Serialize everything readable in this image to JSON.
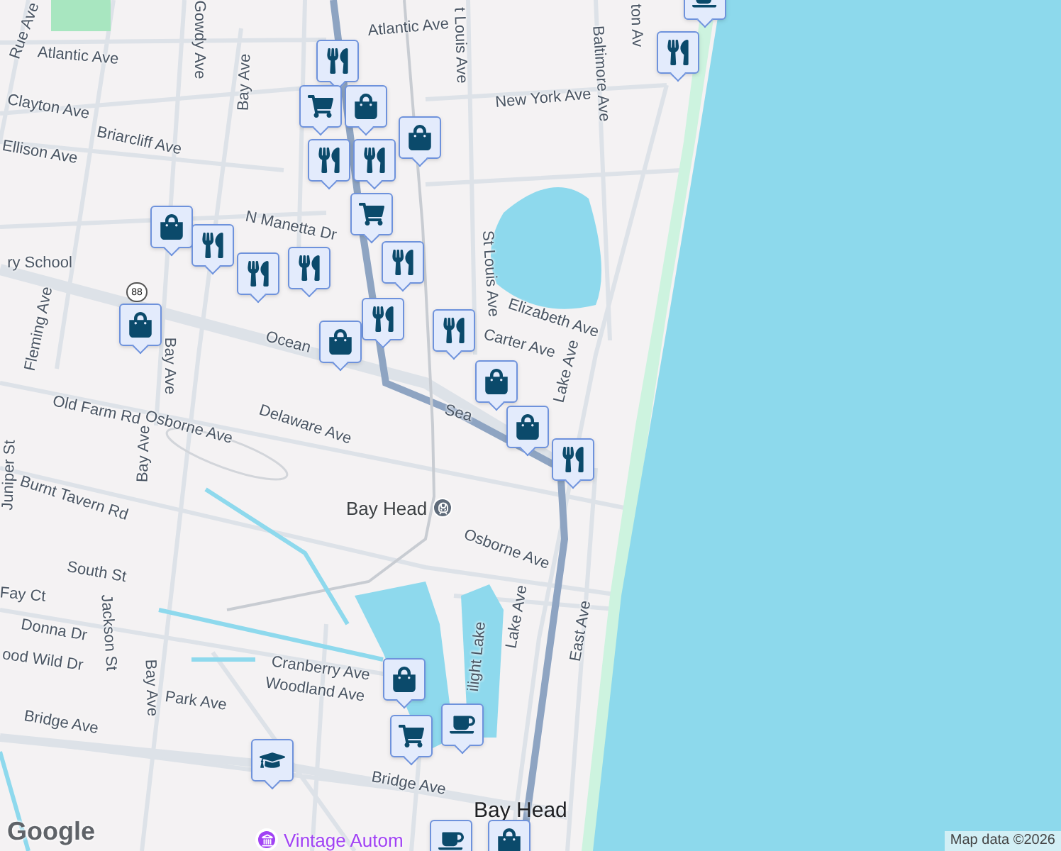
{
  "map": {
    "labels": [
      {
        "text": "Rue Ave"
      },
      {
        "text": "Atlantic Ave"
      },
      {
        "text": "Gowdy Ave"
      },
      {
        "text": "Bay Ave"
      },
      {
        "text": "Atlantic Ave"
      },
      {
        "text": "t Louis Ave"
      },
      {
        "text": "New York Ave"
      },
      {
        "text": "ton Av"
      },
      {
        "text": "Baltimore Ave"
      },
      {
        "text": "Clayton Ave"
      },
      {
        "text": "Briarcliff Ave"
      },
      {
        "text": "Ellison Ave"
      },
      {
        "text": "N Manetta Dr"
      },
      {
        "text": "ry School"
      },
      {
        "text": "St Louis Ave"
      },
      {
        "text": "Elizabeth Ave"
      },
      {
        "text": "Carter Ave"
      },
      {
        "text": "Fleming Ave"
      },
      {
        "text": "Bay Ave"
      },
      {
        "text": "Ocean"
      },
      {
        "text": "Lake Ave"
      },
      {
        "text": "Sea"
      },
      {
        "text": "Old Farm Rd"
      },
      {
        "text": "Osborne Ave"
      },
      {
        "text": "Delaware Ave"
      },
      {
        "text": "Bay Ave"
      },
      {
        "text": "Juniper St"
      },
      {
        "text": "Burnt Tavern Rd"
      },
      {
        "text": "Osborne Ave"
      },
      {
        "text": "South St"
      },
      {
        "text": "Fay Ct"
      },
      {
        "text": "Jackson St"
      },
      {
        "text": "Donna Dr"
      },
      {
        "text": "Lake Ave"
      },
      {
        "text": "ilight Lake"
      },
      {
        "text": "East Ave"
      },
      {
        "text": "Bay Ave"
      },
      {
        "text": "ood Wild Dr"
      },
      {
        "text": "Cranberry Ave"
      },
      {
        "text": "Woodland Ave"
      },
      {
        "text": "Park Ave"
      },
      {
        "text": "Bridge Ave"
      },
      {
        "text": "Bridge Ave"
      }
    ],
    "station": {
      "name": "Bay Head"
    },
    "town": "Bay Head",
    "poi": {
      "name": "Vintage Autom"
    },
    "route_shield": "88",
    "markers": [
      {
        "kind": "dining"
      },
      {
        "kind": "grocery"
      },
      {
        "kind": "shopping"
      },
      {
        "kind": "dining"
      },
      {
        "kind": "dining"
      },
      {
        "kind": "shopping"
      },
      {
        "kind": "grocery"
      },
      {
        "kind": "dining"
      },
      {
        "kind": "shopping"
      },
      {
        "kind": "dining"
      },
      {
        "kind": "dining"
      },
      {
        "kind": "dining"
      },
      {
        "kind": "shopping"
      },
      {
        "kind": "dining"
      },
      {
        "kind": "shopping"
      },
      {
        "kind": "dining"
      },
      {
        "kind": "shopping"
      },
      {
        "kind": "shopping"
      },
      {
        "kind": "dining"
      },
      {
        "kind": "cafe"
      },
      {
        "kind": "dining"
      },
      {
        "kind": "shopping"
      },
      {
        "kind": "grocery"
      },
      {
        "kind": "cafe"
      },
      {
        "kind": "school"
      },
      {
        "kind": "cafe"
      },
      {
        "kind": "shopping"
      }
    ],
    "logo": "Google",
    "attribution": "Map data ©2026"
  }
}
